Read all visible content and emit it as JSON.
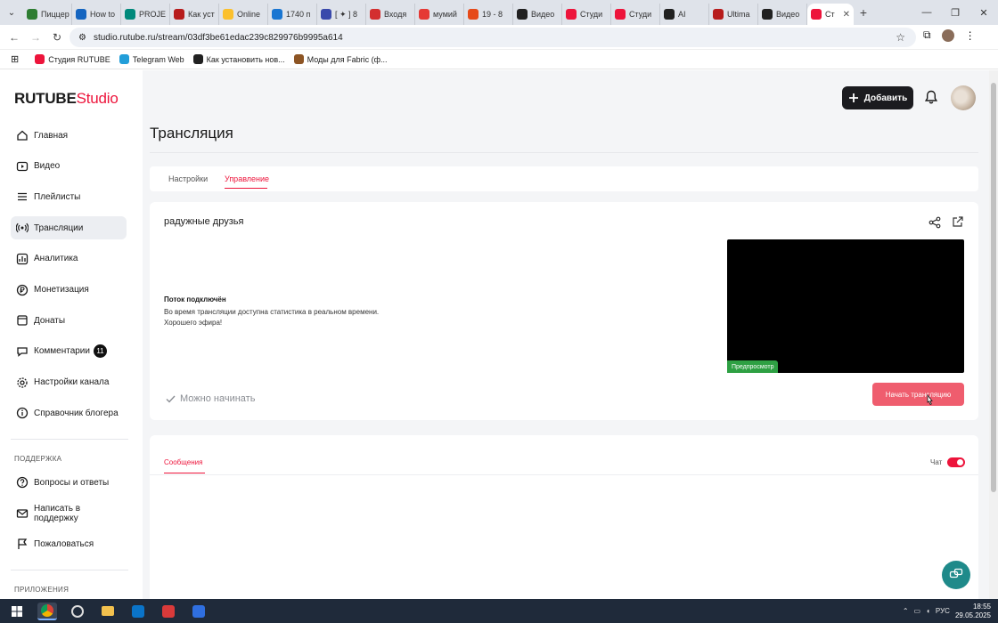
{
  "browser": {
    "tabs": [
      {
        "label": "Пиццер",
        "color": "#2e7d32"
      },
      {
        "label": "How to",
        "color": "#1565c0"
      },
      {
        "label": "PROJE",
        "color": "#00897b"
      },
      {
        "label": "Как уст",
        "color": "#b71c1c"
      },
      {
        "label": "Online",
        "color": "#fbc02d"
      },
      {
        "label": "1740 п",
        "color": "#1976d2"
      },
      {
        "label": "[ ✦ ] 8",
        "color": "#3949ab"
      },
      {
        "label": "Входя",
        "color": "#d32f2f"
      },
      {
        "label": "мумий",
        "color": "#e53935"
      },
      {
        "label": "19 - 8",
        "color": "#e64a19"
      },
      {
        "label": "Видео",
        "color": "#212121"
      },
      {
        "label": "Студи",
        "color": "#ed143b"
      },
      {
        "label": "Студи",
        "color": "#ed143b"
      },
      {
        "label": "AI",
        "color": "#212121"
      },
      {
        "label": "Ultima",
        "color": "#b71c1c"
      },
      {
        "label": "Видео",
        "color": "#212121"
      }
    ],
    "active_tab": {
      "label": "Ст",
      "color": "#ed143b"
    },
    "url": "studio.rutube.ru/stream/03df3be61edac239c829976b9995a614",
    "bookmarks": [
      {
        "label": "Студия RUTUBE",
        "color": "#ed143b"
      },
      {
        "label": "Telegram Web",
        "color": "#229ed9"
      },
      {
        "label": "Как установить нов...",
        "color": "#212121"
      },
      {
        "label": "Моды для Fabric (ф...",
        "color": "#8d5524"
      }
    ]
  },
  "app": {
    "logo_main": "RUTUBE",
    "logo_studio": "Studio",
    "add_button": "Добавить",
    "nav": [
      {
        "label": "Главная",
        "icon": "home-icon"
      },
      {
        "label": "Видео",
        "icon": "video-icon"
      },
      {
        "label": "Плейлисты",
        "icon": "playlist-icon"
      },
      {
        "label": "Трансляции",
        "icon": "broadcast-icon"
      },
      {
        "label": "Аналитика",
        "icon": "analytics-icon"
      },
      {
        "label": "Монетизация",
        "icon": "ruble-icon"
      },
      {
        "label": "Донаты",
        "icon": "donate-icon"
      },
      {
        "label": "Комментарии",
        "icon": "comment-icon",
        "badge": "11"
      },
      {
        "label": "Настройки канала",
        "icon": "gear-icon"
      },
      {
        "label": "Справочник блогера",
        "icon": "info-icon"
      }
    ],
    "support_label": "ПОДДЕРЖКА",
    "support_nav": [
      {
        "label": "Вопросы и ответы",
        "icon": "question-icon"
      },
      {
        "label": "Написать в поддержку",
        "icon": "mail-icon"
      },
      {
        "label": "Пожаловаться",
        "icon": "flag-icon"
      }
    ],
    "apps_label": "ПРИЛОЖЕНИЯ",
    "page_title": "Трансляция",
    "tabs": [
      "Настройки",
      "Управление"
    ],
    "stream": {
      "name": "радужные друзья",
      "status_title": "Поток подключён",
      "status_line1": "Во время трансляции доступна статистика в реальном времени.",
      "status_line2": "Хорошего эфира!",
      "ready": "Можно начинать",
      "preview_badge": "Предпросмотр",
      "start_button": "Начать трансляцию"
    },
    "chat": {
      "tab": "Сообщения",
      "toggle_label": "Чат",
      "enabled": true
    }
  },
  "taskbar": {
    "lang": "РУС",
    "time": "18:55",
    "date": "29.05.2025"
  }
}
